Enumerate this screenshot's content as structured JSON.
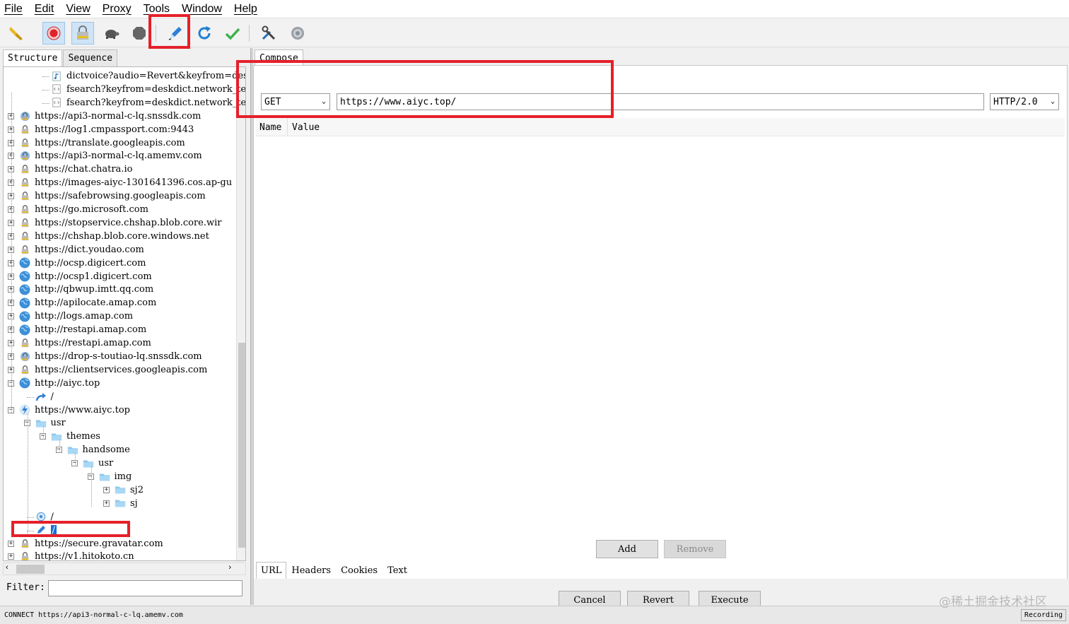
{
  "menu": [
    "File",
    "Edit",
    "View",
    "Proxy",
    "Tools",
    "Window",
    "Help"
  ],
  "toolbar": {
    "buttons": [
      "broom-icon",
      "record-icon",
      "ssl-lock-icon",
      "turtle-icon",
      "stop-hexagon-icon",
      "compose-pen-icon",
      "refresh-icon",
      "validate-check-icon",
      "tools-icon",
      "settings-gear-icon"
    ]
  },
  "left": {
    "tabs": [
      "Structure",
      "Sequence"
    ],
    "tree": [
      {
        "text": "dictvoice?audio=Revert&keyfrom=deskdict",
        "icon": "audio-file-icon",
        "level": 2
      },
      {
        "text": "fsearch?keyfrom=deskdict.network_test",
        "icon": "code-file-icon",
        "level": 2
      },
      {
        "text": "fsearch?keyfrom=deskdict.network_test",
        "icon": "code-file-icon",
        "level": 2
      },
      {
        "text": "https://api3-normal-c-lq.snssdk.com",
        "icon": "lock-globe-icon",
        "level": 0,
        "exp": "+"
      },
      {
        "text": "https://log1.cmpassport.com:9443",
        "icon": "lock-icon",
        "level": 0,
        "exp": "+"
      },
      {
        "text": "https://translate.googleapis.com",
        "icon": "lock-icon",
        "level": 0,
        "exp": "+"
      },
      {
        "text": "https://api3-normal-c-lq.amemv.com",
        "icon": "lock-globe-icon",
        "level": 0,
        "exp": "+"
      },
      {
        "text": "https://chat.chatra.io",
        "icon": "lock-icon",
        "level": 0,
        "exp": "+"
      },
      {
        "text": "https://images-aiyc-1301641396.cos.ap-gu",
        "icon": "lock-icon",
        "level": 0,
        "exp": "+"
      },
      {
        "text": "https://safebrowsing.googleapis.com",
        "icon": "lock-icon",
        "level": 0,
        "exp": "+"
      },
      {
        "text": "https://go.microsoft.com",
        "icon": "lock-icon",
        "level": 0,
        "exp": "+"
      },
      {
        "text": "https://stopservice.chshap.blob.core.wir",
        "icon": "lock-icon",
        "level": 0,
        "exp": "+"
      },
      {
        "text": "https://chshap.blob.core.windows.net",
        "icon": "lock-icon",
        "level": 0,
        "exp": "+"
      },
      {
        "text": "https://dict.youdao.com",
        "icon": "lock-icon",
        "level": 0,
        "exp": "+"
      },
      {
        "text": "http://ocsp.digicert.com",
        "icon": "globe-icon",
        "level": 0,
        "exp": "+"
      },
      {
        "text": "http://ocsp1.digicert.com",
        "icon": "globe-icon",
        "level": 0,
        "exp": "+"
      },
      {
        "text": "http://qbwup.imtt.qq.com",
        "icon": "globe-icon",
        "level": 0,
        "exp": "+"
      },
      {
        "text": "http://apilocate.amap.com",
        "icon": "globe-icon",
        "level": 0,
        "exp": "+"
      },
      {
        "text": "http://logs.amap.com",
        "icon": "globe-icon",
        "level": 0,
        "exp": "+"
      },
      {
        "text": "http://restapi.amap.com",
        "icon": "globe-icon",
        "level": 0,
        "exp": "+"
      },
      {
        "text": "https://restapi.amap.com",
        "icon": "lock-icon",
        "level": 0,
        "exp": "+"
      },
      {
        "text": "https://drop-s-toutiao-lq.snssdk.com",
        "icon": "lock-globe-icon",
        "level": 0,
        "exp": "+"
      },
      {
        "text": "https://clientservices.googleapis.com",
        "icon": "lock-icon",
        "level": 0,
        "exp": "+"
      },
      {
        "text": "http://aiyc.top",
        "icon": "globe-icon",
        "level": 0,
        "exp": "−"
      },
      {
        "text": "/",
        "icon": "redirect-arrow-icon",
        "level": 1
      },
      {
        "text": "https://www.aiyc.top",
        "icon": "lightning-icon",
        "level": 0,
        "exp": "−"
      },
      {
        "text": "usr",
        "icon": "folder-icon",
        "level": 1,
        "exp": "−"
      },
      {
        "text": "themes",
        "icon": "folder-icon",
        "level": 2,
        "exp": "−"
      },
      {
        "text": "handsome",
        "icon": "folder-icon",
        "level": 3,
        "exp": "−"
      },
      {
        "text": "usr",
        "icon": "folder-icon",
        "level": 4,
        "exp": "−"
      },
      {
        "text": "img",
        "icon": "folder-icon",
        "level": 5,
        "exp": "−"
      },
      {
        "text": "sj2",
        "icon": "folder-icon",
        "level": 6,
        "exp": "+"
      },
      {
        "text": "sj",
        "icon": "folder-icon",
        "level": 6,
        "exp": "+"
      },
      {
        "text": "/",
        "icon": "cycle-icon",
        "level": 1
      },
      {
        "text": "/",
        "icon": "compose-pen-icon",
        "level": 1,
        "selected": true
      },
      {
        "text": "https://secure.gravatar.com",
        "icon": "lock-icon",
        "level": 0,
        "exp": "+"
      },
      {
        "text": "https://v1.hitokoto.cn",
        "icon": "lock-icon",
        "level": 0,
        "exp": "+"
      }
    ],
    "filter_label": "Filter:",
    "filter_value": ""
  },
  "compose": {
    "tab": "Compose",
    "method": "GET",
    "url": "https://www.aiyc.top/",
    "protocol": "HTTP/2.0",
    "col_name": "Name",
    "col_value": "Value",
    "add": "Add",
    "remove": "Remove",
    "subtabs": [
      "URL",
      "Headers",
      "Cookies",
      "Text"
    ],
    "cancel": "Cancel",
    "revert": "Revert",
    "execute": "Execute"
  },
  "status": {
    "text": "CONNECT https://api3-normal-c-lq.amemv.com",
    "recording": "Recording"
  },
  "watermark": "@稀土掘金技术社区",
  "colors": {
    "annotation": "#e5202a",
    "selection": "#1a6fd4",
    "globe": "#3d8fd6",
    "folder": "#8cc8ee"
  }
}
